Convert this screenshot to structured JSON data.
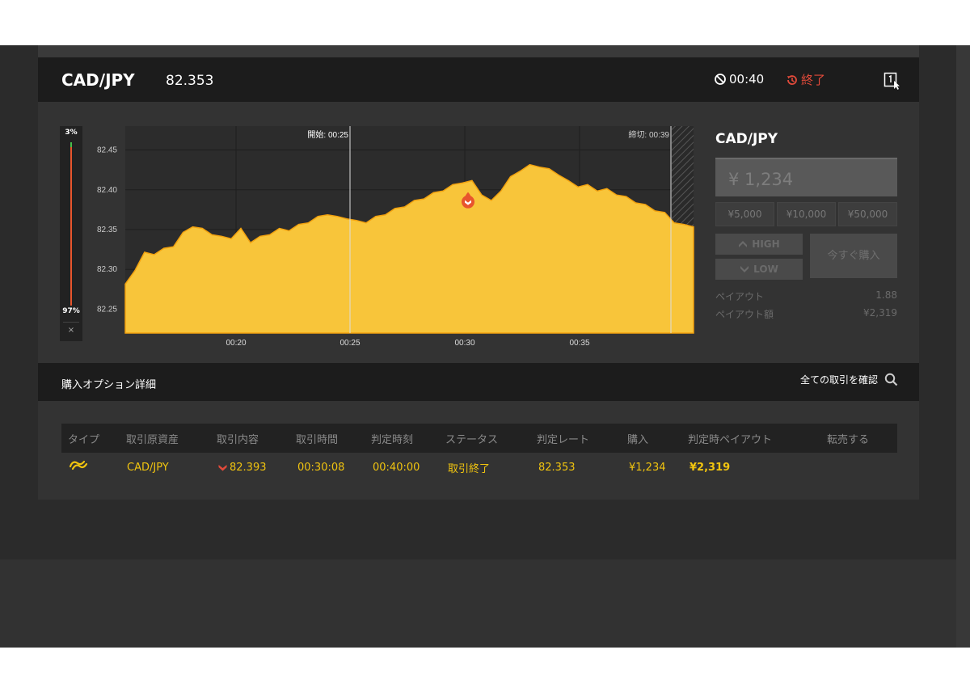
{
  "header": {
    "pair": "CAD/JPY",
    "rate": "82.353",
    "timer": "00:40",
    "status": "終了"
  },
  "gauge": {
    "top_pct": "3%",
    "bottom_pct": "97%",
    "close": "×",
    "up_fraction": 0.03,
    "down_fraction": 0.97
  },
  "chart_data": {
    "type": "area",
    "y_ticks": [
      "82.45",
      "82.40",
      "82.35",
      "82.30",
      "82.25"
    ],
    "x_ticks": [
      "00:20",
      "00:25",
      "00:30",
      "00:35"
    ],
    "ylim": [
      82.22,
      82.48
    ],
    "start_label": "開始: 00:25",
    "end_label": "締切: 00:39",
    "entry_value": 82.393,
    "fill_color": "#f8c53a",
    "series": [
      {
        "values": [
          82.28,
          82.3,
          82.32,
          82.32,
          82.325,
          82.33,
          82.345,
          82.355,
          82.35,
          82.345,
          82.34,
          82.34,
          82.35,
          82.335,
          82.34,
          82.345,
          82.35,
          82.35,
          82.355,
          82.36,
          82.365,
          82.37,
          82.365,
          82.365,
          82.36,
          82.36,
          82.365,
          82.37,
          82.375,
          82.38,
          82.385,
          82.39,
          82.395,
          82.4,
          82.405,
          82.41,
          82.41,
          82.395,
          82.385,
          82.4,
          82.415,
          82.425,
          82.43,
          82.43,
          82.425,
          82.42,
          82.41,
          82.405,
          82.405,
          82.4,
          82.4,
          82.395,
          82.39,
          82.385,
          82.38,
          82.375,
          82.37,
          82.36,
          82.355,
          82.355
        ]
      }
    ]
  },
  "trade": {
    "title": "CAD/JPY",
    "amount": "¥ 1,234",
    "presets": [
      "¥5,000",
      "¥10,000",
      "¥50,000"
    ],
    "high": "HIGH",
    "low": "LOW",
    "buy_now": "今すぐ購入",
    "payout_label": "ペイアウト",
    "payout_value": "1.88",
    "payout_amount_label": "ペイアウト額",
    "payout_amount_value": "¥2,319"
  },
  "options": {
    "title": "購入オプション詳細",
    "link": "全ての取引を確認"
  },
  "table": {
    "headers": [
      "タイプ",
      "取引原資産",
      "取引内容",
      "取引時間",
      "判定時刻",
      "ステータス",
      "判定レート",
      "購入",
      "判定時ペイアウト",
      "転売する"
    ],
    "row": {
      "asset": "CAD/JPY",
      "content": "82.393",
      "trade_time": "00:30:08",
      "judge_time": "00:40:00",
      "status": "取引終了",
      "judge_rate": "82.353",
      "purchase": "¥1,234",
      "payout": "¥2,319"
    }
  },
  "colors": {
    "accent": "#f8c53a",
    "red": "#e24a3a",
    "yellow_text": "#f1c40f"
  }
}
